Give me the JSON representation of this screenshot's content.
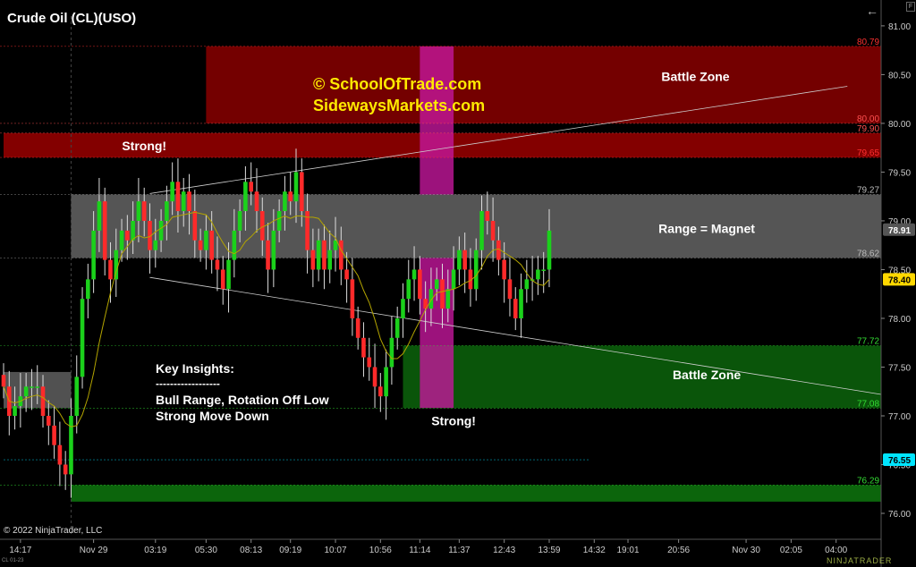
{
  "header": {
    "title": "Crude Oil (CL)(USO)",
    "back_icon": "arrow-left-icon",
    "flag_letter": "F"
  },
  "footer": {
    "copyright": "© 2022 NinjaTrader, LLC",
    "brand": "NINJATRADER",
    "contract": "CL 01-23"
  },
  "promo": {
    "line1": "© SchoolOfTrade.com",
    "line2": "SidewaysMarkets.com"
  },
  "colors": {
    "bull": "#1bd11b",
    "bear": "#ff2a2a",
    "ma": "#b3a400",
    "resistance_zone": "#7a0000",
    "support_zone": "#0b5a0b",
    "range_zone": "#5a5a5a",
    "magenta_bar": "#c3179b",
    "price_tag": "#ffd800",
    "cyan_tag": "#00e5ff"
  },
  "chart_data": {
    "type": "candlestick",
    "ylim": [
      75.78,
      81.1
    ],
    "y_ticks": [
      76.0,
      76.5,
      77.0,
      77.5,
      78.0,
      78.5,
      79.0,
      79.5,
      80.0,
      80.5,
      81.0
    ],
    "y_tick_labels": [
      "76.00",
      "76.50",
      "77.00",
      "77.50",
      "78.00",
      "78.50",
      "79.00",
      "79.50",
      "80.00",
      "80.50",
      "81.00"
    ],
    "x_ticks": [
      {
        "label": "14:17",
        "i": 3
      },
      {
        "label": "Nov 29",
        "i": 16
      },
      {
        "label": "03:19",
        "i": 27
      },
      {
        "label": "05:30",
        "i": 36
      },
      {
        "label": "08:13",
        "i": 44
      },
      {
        "label": "09:19",
        "i": 51
      },
      {
        "label": "10:07",
        "i": 59
      },
      {
        "label": "10:56",
        "i": 67
      },
      {
        "label": "11:14",
        "i": 74
      },
      {
        "label": "11:37",
        "i": 81
      },
      {
        "label": "12:43",
        "i": 89
      },
      {
        "label": "13:59",
        "i": 97
      },
      {
        "label": "14:32",
        "i": 105
      },
      {
        "label": "19:01",
        "i": 111
      },
      {
        "label": "20:56",
        "i": 120
      },
      {
        "label": "Nov 30",
        "i": 132
      },
      {
        "label": "02:05",
        "i": 140
      },
      {
        "label": "04:00",
        "i": 148
      }
    ],
    "x_index_range": [
      0,
      156
    ],
    "closes": [
      77.3,
      77.0,
      77.1,
      77.2,
      77.3,
      77.3,
      77.3,
      77.0,
      76.9,
      76.7,
      76.5,
      76.4,
      77.0,
      77.4,
      78.2,
      78.4,
      78.9,
      79.2,
      78.6,
      78.4,
      78.7,
      78.9,
      78.8,
      79.0,
      79.2,
      79.0,
      78.7,
      78.8,
      79.0,
      79.2,
      79.4,
      79.1,
      79.3,
      79.1,
      78.8,
      78.7,
      78.9,
      78.6,
      78.5,
      78.3,
      78.6,
      78.9,
      79.1,
      79.4,
      79.3,
      79.1,
      78.8,
      78.5,
      78.9,
      79.1,
      79.3,
      79.2,
      79.5,
      79.1,
      78.7,
      78.5,
      78.8,
      78.5,
      78.7,
      78.8,
      78.5,
      78.4,
      78.0,
      77.8,
      77.6,
      77.5,
      77.3,
      77.2,
      77.5,
      77.8,
      78.0,
      78.2,
      78.4,
      78.5,
      78.2,
      78.1,
      78.3,
      78.4,
      78.1,
      78.3,
      78.5,
      78.7,
      78.5,
      78.3,
      78.7,
      79.1,
      79.0,
      78.8,
      78.6,
      78.4,
      78.2,
      78.0,
      78.3,
      78.4,
      78.4,
      78.5,
      78.5,
      78.9
    ],
    "levels": [
      {
        "label": "80.79",
        "value": 80.79,
        "color": "#ff3030"
      },
      {
        "label": "80.00",
        "value": 80.0,
        "color": "#ff5050"
      },
      {
        "label": "79.90",
        "value": 79.9,
        "color": "#ff5050"
      },
      {
        "label": "79.65",
        "value": 79.65,
        "color": "#ff3030"
      },
      {
        "label": "79.27",
        "value": 79.27,
        "color": "#bbbbbb"
      },
      {
        "label": "78.62",
        "value": 78.62,
        "color": "#bbbbbb"
      },
      {
        "label": "77.72",
        "value": 77.72,
        "color": "#33dd33"
      },
      {
        "label": "77.08",
        "value": 77.08,
        "color": "#33dd33"
      },
      {
        "label": "76.29",
        "value": 76.29,
        "color": "#33dd33"
      }
    ],
    "price_tags": [
      {
        "label": "78.91",
        "value": 78.91,
        "bg": "#555555",
        "fg": "#ffffff"
      },
      {
        "label": "78.40",
        "value": 78.4,
        "bg": "#ffd800",
        "fg": "#000000"
      },
      {
        "label": "76.55",
        "value": 76.55,
        "bg": "#00e5ff",
        "fg": "#000000"
      }
    ],
    "zones": [
      {
        "name": "battle-zone-upper",
        "y0": 80.0,
        "y1": 80.79,
        "i0": 36,
        "i1": 156,
        "color": "#7a0000"
      },
      {
        "name": "strong-upper-band",
        "y0": 79.65,
        "y1": 79.9,
        "i0": 0,
        "i1": 156,
        "color": "#8a0000"
      },
      {
        "name": "range-magnet",
        "y0": 78.62,
        "y1": 79.27,
        "i0": 12,
        "i1": 156,
        "color": "#5a5a5a"
      },
      {
        "name": "battle-zone-lower",
        "y0": 77.08,
        "y1": 77.72,
        "i0": 71,
        "i1": 156,
        "color": "#0b5a0b"
      },
      {
        "name": "support-band",
        "y0": 76.12,
        "y1": 76.29,
        "i0": 12,
        "i1": 156,
        "color": "#0d6a0d"
      },
      {
        "name": "left-range-box",
        "y0": 77.08,
        "y1": 77.45,
        "i0": 0,
        "i1": 12,
        "color": "#555555"
      }
    ],
    "magenta_bars": [
      {
        "y0": 79.27,
        "y1": 80.79,
        "i0": 74,
        "i1": 80
      },
      {
        "y0": 77.08,
        "y1": 78.62,
        "i0": 74,
        "i1": 80
      }
    ],
    "annotations": [
      {
        "text": "Battle Zone",
        "i": 123,
        "y": 80.48
      },
      {
        "text": "Strong!",
        "i": 25,
        "y": 79.77
      },
      {
        "text": "Range = Magnet",
        "i": 125,
        "y": 78.92
      },
      {
        "text": "Battle Zone",
        "i": 125,
        "y": 77.42
      },
      {
        "text": "Strong!",
        "i": 80,
        "y": 76.95
      }
    ],
    "insights": {
      "title": "Key Insights:",
      "divider": "------------------",
      "lines": [
        "Bull Range, Rotation Off Low",
        "Strong Move Down"
      ]
    }
  }
}
